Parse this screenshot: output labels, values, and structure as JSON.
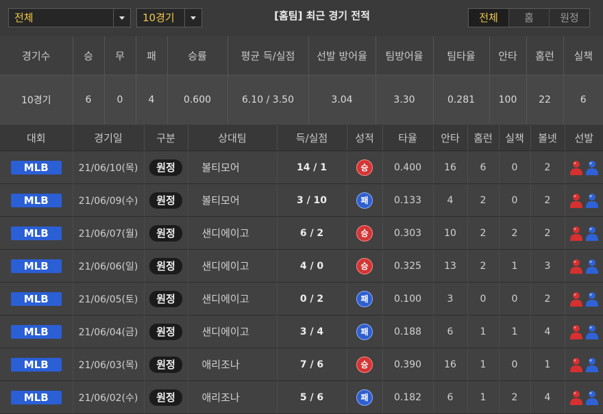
{
  "filters": {
    "scope_select": "전체",
    "games_select": "10경기"
  },
  "title": "[홈팀] 최근 경기 전적",
  "segment_tabs": [
    {
      "label": "전체",
      "active": true
    },
    {
      "label": "홈",
      "active": false
    },
    {
      "label": "원정",
      "active": false
    }
  ],
  "summary": {
    "headers": [
      "경기수",
      "승",
      "무",
      "패",
      "승률",
      "평균 득/실점",
      "선발 방어율",
      "팀방어율",
      "팀타율",
      "안타",
      "홈런",
      "실책"
    ],
    "values": [
      "10경기",
      "6",
      "0",
      "4",
      "0.600",
      "6.10 / 3.50",
      "3.04",
      "3.30",
      "0.281",
      "100",
      "22",
      "6"
    ]
  },
  "games": {
    "headers": [
      "대회",
      "경기일",
      "구분",
      "상대팀",
      "득/실점",
      "성적",
      "타율",
      "안타",
      "홈런",
      "실책",
      "볼넷",
      "선발"
    ],
    "rows": [
      {
        "league": "MLB",
        "date": "21/06/10(목)",
        "type": "원정",
        "opponent": "볼티모어",
        "score": "14 / 1",
        "result": "승",
        "avg": "0.400",
        "hits": "16",
        "hr": "6",
        "errors": "0",
        "walks": "2"
      },
      {
        "league": "MLB",
        "date": "21/06/09(수)",
        "type": "원정",
        "opponent": "볼티모어",
        "score": "3 / 10",
        "result": "패",
        "avg": "0.133",
        "hits": "4",
        "hr": "2",
        "errors": "0",
        "walks": "2"
      },
      {
        "league": "MLB",
        "date": "21/06/07(월)",
        "type": "원정",
        "opponent": "샌디에이고",
        "score": "6 / 2",
        "result": "승",
        "avg": "0.303",
        "hits": "10",
        "hr": "2",
        "errors": "2",
        "walks": "2"
      },
      {
        "league": "MLB",
        "date": "21/06/06(일)",
        "type": "원정",
        "opponent": "샌디에이고",
        "score": "4 / 0",
        "result": "승",
        "avg": "0.325",
        "hits": "13",
        "hr": "2",
        "errors": "1",
        "walks": "3"
      },
      {
        "league": "MLB",
        "date": "21/06/05(토)",
        "type": "원정",
        "opponent": "샌디에이고",
        "score": "0 / 2",
        "result": "패",
        "avg": "0.100",
        "hits": "3",
        "hr": "0",
        "errors": "0",
        "walks": "2"
      },
      {
        "league": "MLB",
        "date": "21/06/04(금)",
        "type": "원정",
        "opponent": "샌디에이고",
        "score": "3 / 4",
        "result": "패",
        "avg": "0.188",
        "hits": "6",
        "hr": "1",
        "errors": "1",
        "walks": "4"
      },
      {
        "league": "MLB",
        "date": "21/06/03(목)",
        "type": "원정",
        "opponent": "애리조나",
        "score": "7 / 6",
        "result": "승",
        "avg": "0.390",
        "hits": "16",
        "hr": "1",
        "errors": "0",
        "walks": "1"
      },
      {
        "league": "MLB",
        "date": "21/06/02(수)",
        "type": "원정",
        "opponent": "애리조나",
        "score": "5 / 6",
        "result": "패",
        "avg": "0.182",
        "hits": "6",
        "hr": "1",
        "errors": "2",
        "walks": "4"
      }
    ]
  },
  "colors": {
    "accent": "#f2c94c",
    "mlb_badge": "#2b5fd6",
    "win": "#d43535",
    "loss": "#2f5fcf",
    "pitcher_home": "#d63030",
    "pitcher_away": "#2f62d6"
  },
  "icons": {
    "starter_icons": [
      "person-red-icon",
      "person-blue-icon"
    ]
  }
}
